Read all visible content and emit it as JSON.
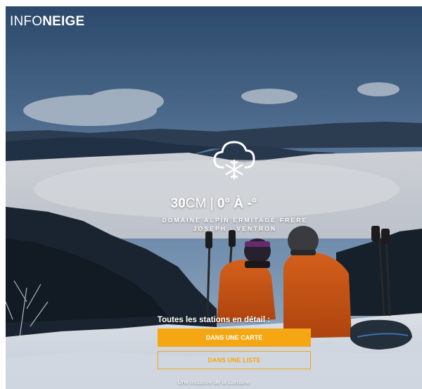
{
  "brand": {
    "light": "INFO",
    "bold": "NEIGE"
  },
  "weather": {
    "icon": "snow-cloud-icon"
  },
  "conditions": {
    "snow": "30",
    "snow_unit": "CM",
    "separator": " | ",
    "temperature": "0° À -°"
  },
  "station": {
    "line1": "DOMAINE ALPIN ERMITAGE FRERE",
    "line2": "JOSEPH - VENTRON"
  },
  "cta": {
    "label": "Toutes les stations en détail :",
    "map_button": "DANS UNE CARTE",
    "list_button": "DANS UNE LISTE"
  },
  "footer": {
    "note": "Une initiative de la Lorraine"
  },
  "colors": {
    "accent": "#f5a713",
    "text": "#ffffff"
  }
}
